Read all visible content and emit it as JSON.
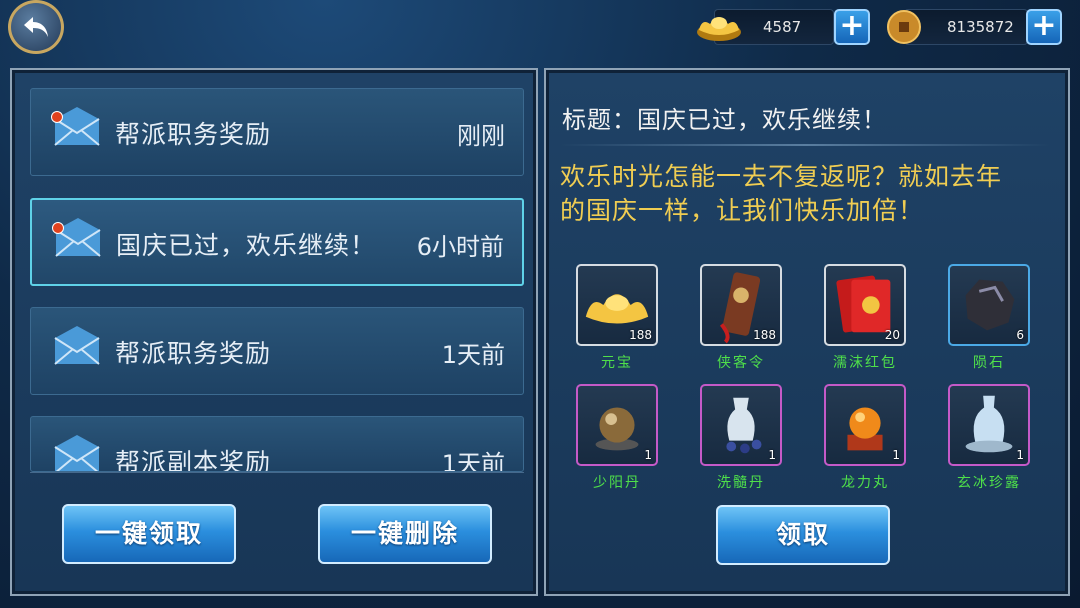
{
  "topbar": {
    "back_icon": "back-arrow-icon",
    "gold_value": "4587",
    "gold_icon": "gold-ingot-icon",
    "coin_value": "8135872",
    "coin_icon": "copper-coin-icon",
    "plus_symbol": "+"
  },
  "mail_list": [
    {
      "title": "帮派职务奖励",
      "time": "刚刚",
      "unread": true,
      "selected": false
    },
    {
      "title": "国庆已过，欢乐继续！",
      "time": "6小时前",
      "unread": true,
      "selected": true
    },
    {
      "title": "帮派职务奖励",
      "time": "1天前",
      "unread": false,
      "selected": false
    },
    {
      "title": "帮派副本奖励",
      "time": "1天前",
      "unread": false,
      "selected": false
    }
  ],
  "left_buttons": {
    "claim_all": "一键领取",
    "delete_all": "一键删除"
  },
  "detail": {
    "subject": "标题：国庆已过，欢乐继续！",
    "body_line1": "欢乐时光怎能一去不复返呢？就如去年",
    "body_line2": "的国庆一样，让我们快乐加倍！",
    "claim_button": "领取"
  },
  "rewards": [
    {
      "name": "元宝",
      "qty": "188",
      "quality": "white",
      "icon": "gold-ingot-icon"
    },
    {
      "name": "侠客令",
      "qty": "188",
      "quality": "white",
      "icon": "token-plaque-icon"
    },
    {
      "name": "濡沫红包",
      "qty": "20",
      "quality": "white",
      "icon": "red-envelope-icon"
    },
    {
      "name": "陨石",
      "qty": "6",
      "quality": "blue",
      "icon": "meteorite-icon"
    },
    {
      "name": "少阳丹",
      "qty": "1",
      "quality": "purple",
      "icon": "pill-orb-icon"
    },
    {
      "name": "洗髓丹",
      "qty": "1",
      "quality": "purple",
      "icon": "vase-pills-icon"
    },
    {
      "name": "龙力丸",
      "qty": "1",
      "quality": "purple",
      "icon": "amber-orb-icon"
    },
    {
      "name": "玄冰珍露",
      "qty": "1",
      "quality": "purple",
      "icon": "ice-vase-icon"
    }
  ],
  "colors": {
    "accent_blue": "#2b8fde",
    "body_text": "#f0cd52",
    "item_name": "#4fe04a",
    "unread_dot": "#e0421e"
  }
}
